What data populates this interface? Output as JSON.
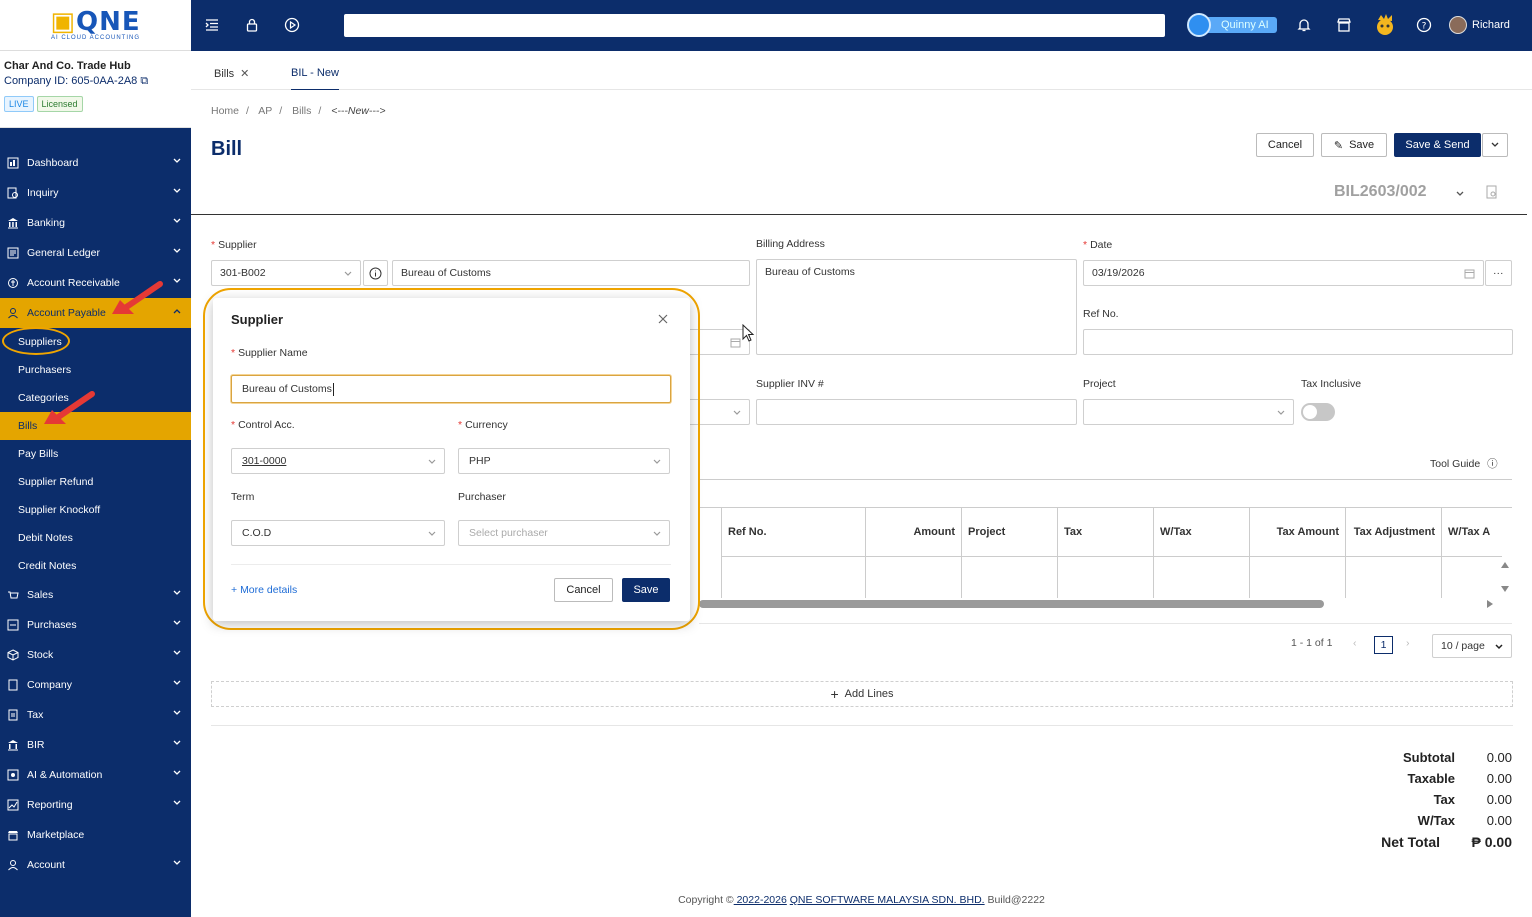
{
  "sidebar": {
    "logo_text": "QNE",
    "logo_sub": "AI CLOUD ACCOUNTING",
    "company_name": "Char And Co. Trade Hub",
    "company_id": "Company ID: 605-0AA-2A8",
    "badge_live": "LIVE",
    "badge_licensed": "Licensed",
    "items": [
      {
        "label": "Dashboard",
        "icon": "dashboard-icon"
      },
      {
        "label": "Inquiry",
        "icon": "inquiry-icon"
      },
      {
        "label": "Banking",
        "icon": "bank-icon"
      },
      {
        "label": "General Ledger",
        "icon": "ledger-icon"
      },
      {
        "label": "Account Receivable",
        "icon": "receivable-icon"
      },
      {
        "label": "Account Payable",
        "icon": "payable-icon"
      }
    ],
    "sub_items": [
      "Suppliers",
      "Purchasers",
      "Categories",
      "Bills",
      "Pay Bills",
      "Supplier Refund",
      "Supplier Knockoff",
      "Debit Notes",
      "Credit Notes"
    ],
    "items_after": [
      {
        "label": "Sales",
        "icon": "sales-icon"
      },
      {
        "label": "Purchases",
        "icon": "purchases-icon"
      },
      {
        "label": "Stock",
        "icon": "stock-icon"
      },
      {
        "label": "Company",
        "icon": "company-icon"
      },
      {
        "label": "Tax",
        "icon": "tax-icon"
      },
      {
        "label": "BIR",
        "icon": "bir-icon"
      },
      {
        "label": "AI & Automation",
        "icon": "ai-icon"
      },
      {
        "label": "Reporting",
        "icon": "reporting-icon"
      },
      {
        "label": "Marketplace",
        "icon": "marketplace-icon"
      },
      {
        "label": "Account",
        "icon": "account-icon"
      }
    ]
  },
  "topbar": {
    "quinny": "Quinny AI",
    "user": "Richard"
  },
  "tabs": [
    {
      "label": "Bills"
    },
    {
      "label": "BIL - New"
    }
  ],
  "breadcrumb": [
    "Home",
    "AP",
    "Bills",
    "<---New--->"
  ],
  "page_title": "Bill",
  "actions": {
    "cancel": "Cancel",
    "save": "Save",
    "save_send": "Save & Send"
  },
  "doc_no": "BIL2603/002",
  "form": {
    "supplier_label": "Supplier",
    "supplier_code": "301-B002",
    "supplier_name": "Bureau of Customs",
    "billing_label": "Billing Address",
    "billing_value": "Bureau of Customs",
    "date_label": "Date",
    "date_value": "03/19/2026",
    "refno_label": "Ref No.",
    "supplier_inv_label": "Supplier INV #",
    "project_label": "Project",
    "tax_inclusive_label": "Tax Inclusive",
    "tool_guide": "Tool Guide"
  },
  "table": {
    "columns": [
      "Ref No.",
      "Amount",
      "Project",
      "Tax",
      "W/Tax",
      "Tax Amount",
      "Tax Adjustment",
      "W/Tax A"
    ]
  },
  "pager": {
    "range": "1 - 1 of 1",
    "page": "1",
    "size": "10 / page"
  },
  "add_lines": "Add Lines",
  "totals": [
    {
      "k": "Subtotal",
      "v": "0.00"
    },
    {
      "k": "Taxable",
      "v": "0.00"
    },
    {
      "k": "Tax",
      "v": "0.00"
    },
    {
      "k": "W/Tax",
      "v": "0.00"
    },
    {
      "k": "Net Total",
      "v": "₱ 0.00"
    }
  ],
  "footer": {
    "prefix": "Copyright ©",
    "years": " 2022-2026",
    "company": "QNE SOFTWARE MALAYSIA SDN. BHD.",
    "build": "Build@2222"
  },
  "popup": {
    "title": "Supplier",
    "name_label": "Supplier Name",
    "name_value": "Bureau of Customs",
    "control_label": "Control Acc.",
    "control_value": "301-0000",
    "currency_label": "Currency",
    "currency_value": "PHP",
    "term_label": "Term",
    "term_value": "C.O.D",
    "purchaser_label": "Purchaser",
    "purchaser_placeholder": "Select purchaser",
    "more_details": "More details",
    "cancel": "Cancel",
    "save": "Save"
  },
  "colors": {
    "navy": "#0c2d6b",
    "accent": "#e4a500",
    "highlight": "#f0a500",
    "arrow": "#e53935"
  }
}
